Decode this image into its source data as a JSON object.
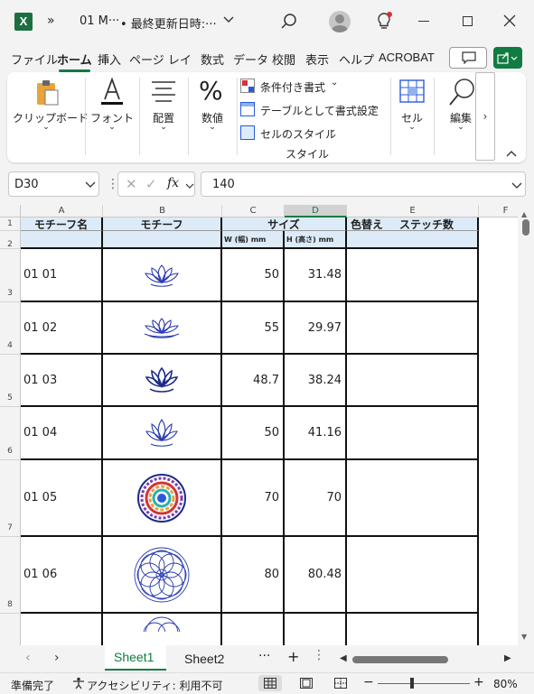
{
  "title": {
    "filename": "01 M···",
    "saved_status": "• 最終更新日時:···"
  },
  "menu_tabs": [
    "ファイル",
    "ホーム",
    "挿入",
    "ページ レイアウ",
    "数式",
    "データ",
    "校閲",
    "表示",
    "ヘルプ",
    "ACROBAT"
  ],
  "ribbon": {
    "clipboard": "クリップボード",
    "font": "フォント",
    "alignment": "配置",
    "number": "数値",
    "conditional": "条件付き書式",
    "format_table": "テーブルとして書式設定",
    "cell_style": "セルのスタイル",
    "styles_label": "スタイル",
    "cells": "セル",
    "editing": "編集"
  },
  "formula_bar": {
    "name_box": "D30",
    "fx": "fx",
    "value": "140"
  },
  "columns": [
    "A",
    "B",
    "C",
    "D",
    "E",
    "F"
  ],
  "header": {
    "motif_name": "モチーフ名",
    "motif": "モチーフ",
    "size": "サイズ",
    "color_change": "色替え",
    "stitch_count": "ステッチ数",
    "width": "W (幅) mm",
    "height": "H (高さ) mm"
  },
  "row_numbers": [
    "1",
    "2",
    "3",
    "4",
    "5",
    "6",
    "7",
    "8"
  ],
  "rows": [
    {
      "name": "01 01",
      "motif": "lotus-outline",
      "w": "50",
      "h": "31.48"
    },
    {
      "name": "01 02",
      "motif": "lotus-layered",
      "w": "55",
      "h": "29.97"
    },
    {
      "name": "01 03",
      "motif": "lotus-filled",
      "w": "48.7",
      "h": "38.24"
    },
    {
      "name": "01 04",
      "motif": "lotus-tall",
      "w": "50",
      "h": "41.16"
    },
    {
      "name": "01 05",
      "motif": "mandala-colored",
      "w": "70",
      "h": "70"
    },
    {
      "name": "01 06",
      "motif": "mandala-circles",
      "w": "80",
      "h": "80.48"
    }
  ],
  "sheet_tabs": [
    "Sheet1",
    "Sheet2"
  ],
  "status": {
    "ready": "準備完了",
    "accessibility": "アクセシビリティ: 利用不可",
    "zoom": "80%"
  },
  "colors": {
    "excel_green": "#107c41",
    "header_fill": "#dcebf7",
    "motif_blue": "#2a3bb0"
  }
}
